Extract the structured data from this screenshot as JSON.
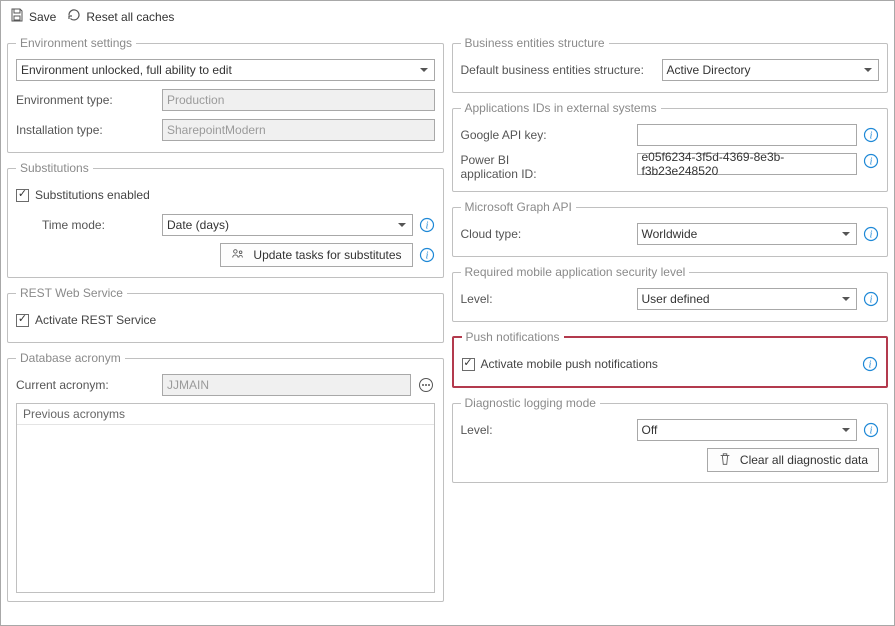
{
  "toolbar": {
    "save_label": "Save",
    "reset_label": "Reset all caches"
  },
  "env_settings": {
    "legend": "Environment settings",
    "lock_state": "Environment unlocked, full ability to edit",
    "env_type_label": "Environment type:",
    "env_type_value": "Production",
    "install_type_label": "Installation type:",
    "install_type_value": "SharepointModern"
  },
  "substitutions": {
    "legend": "Substitutions",
    "enabled_label": "Substitutions enabled",
    "time_mode_label": "Time mode:",
    "time_mode_value": "Date (days)",
    "update_btn": "Update tasks for substitutes"
  },
  "rest": {
    "legend": "REST Web Service",
    "activate_label": "Activate REST Service"
  },
  "db": {
    "legend": "Database acronym",
    "current_label": "Current acronym:",
    "current_value": "JJMAIN",
    "prev_header": "Previous acronyms"
  },
  "bes": {
    "legend": "Business entities structure",
    "default_label": "Default business entities structure:",
    "default_value": "Active Directory"
  },
  "apps": {
    "legend": "Applications IDs in external systems",
    "google_label": "Google API key:",
    "google_value": "",
    "powerbi_label_1": "Power BI",
    "powerbi_label_2": "application ID:",
    "powerbi_value": "e05f6234-3f5d-4369-8e3b-f3b23e248520"
  },
  "graph": {
    "legend": "Microsoft Graph API",
    "cloud_label": "Cloud type:",
    "cloud_value": "Worldwide"
  },
  "mobile_sec": {
    "legend": "Required mobile application security level",
    "level_label": "Level:",
    "level_value": "User defined"
  },
  "push": {
    "legend": "Push notifications",
    "activate_label": "Activate mobile push notifications"
  },
  "diag": {
    "legend": "Diagnostic logging mode",
    "level_label": "Level:",
    "level_value": "Off",
    "clear_btn": "Clear all diagnostic data"
  }
}
